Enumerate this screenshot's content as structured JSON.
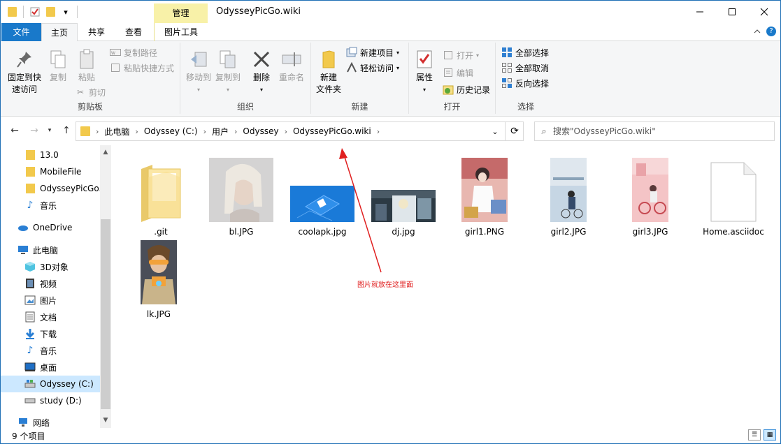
{
  "window": {
    "title": "OdysseyPicGo.wiki",
    "context_tab": "管理",
    "qat_dropdown": "▾"
  },
  "ribbon_tabs": [
    "文件",
    "主页",
    "共享",
    "查看",
    "图片工具"
  ],
  "ribbon": {
    "clipboard": {
      "pin_label": "固定到快速访问",
      "pin_line1": "固定到快",
      "pin_line2": "速访问",
      "copy": "复制",
      "paste": "粘贴",
      "copy_path": "复制路径",
      "paste_shortcut": "粘贴快捷方式",
      "cut": "剪切",
      "group": "剪贴板"
    },
    "organize": {
      "move_to": "移动到",
      "copy_to": "复制到",
      "delete": "删除",
      "rename": "重命名",
      "group": "组织"
    },
    "new": {
      "new_folder_line1": "新建",
      "new_folder_line2": "文件夹",
      "new_item": "新建项目",
      "easy_access": "轻松访问",
      "group": "新建"
    },
    "open": {
      "properties": "属性",
      "open": "打开",
      "edit": "编辑",
      "history": "历史记录",
      "group": "打开"
    },
    "select": {
      "select_all": "全部选择",
      "select_none": "全部取消",
      "invert": "反向选择",
      "group": "选择"
    }
  },
  "address": {
    "crumbs": [
      "此电脑",
      "Odyssey (C:)",
      "用户",
      "Odyssey",
      "OdysseyPicGo.wiki"
    ],
    "search_placeholder": "搜索\"OdysseyPicGo.wiki\""
  },
  "sidebar": {
    "items": [
      {
        "label": "13.0",
        "icon": "folder-icon"
      },
      {
        "label": "MobileFile",
        "icon": "folder-icon"
      },
      {
        "label": "OdysseyPicGo.wiki",
        "icon": "folder-icon"
      },
      {
        "label": "音乐",
        "icon": "music-icon"
      },
      {
        "label": "OneDrive",
        "icon": "cloud-icon"
      },
      {
        "label": "此电脑",
        "icon": "computer-icon"
      },
      {
        "label": "3D对象",
        "icon": "cube-icon"
      },
      {
        "label": "视频",
        "icon": "video-icon"
      },
      {
        "label": "图片",
        "icon": "picture-icon"
      },
      {
        "label": "文档",
        "icon": "document-icon"
      },
      {
        "label": "下载",
        "icon": "download-icon"
      },
      {
        "label": "音乐",
        "icon": "music-icon"
      },
      {
        "label": "桌面",
        "icon": "desktop-icon"
      },
      {
        "label": "Odyssey (C:)",
        "icon": "drive-icon"
      },
      {
        "label": "study (D:)",
        "icon": "drive-icon"
      },
      {
        "label": "网络",
        "icon": "network-icon"
      }
    ]
  },
  "files": [
    {
      "name": ".git",
      "type": "folder"
    },
    {
      "name": "bl.JPG",
      "type": "image"
    },
    {
      "name": "coolapk.jpg",
      "type": "image"
    },
    {
      "name": "dj.jpg",
      "type": "image"
    },
    {
      "name": "girl1.PNG",
      "type": "image"
    },
    {
      "name": "girl2.JPG",
      "type": "image"
    },
    {
      "name": "girl3.JPG",
      "type": "image"
    },
    {
      "name": "Home.asciidoc",
      "type": "document"
    },
    {
      "name": "lk.JPG",
      "type": "image"
    }
  ],
  "annotation": {
    "text": "图片就放在这里面",
    "color": "#e02020"
  },
  "status": {
    "item_count": "9 个项目"
  },
  "colors": {
    "accent": "#1979ca",
    "selection": "#cce8ff",
    "context_tab": "#f8f1a8"
  }
}
